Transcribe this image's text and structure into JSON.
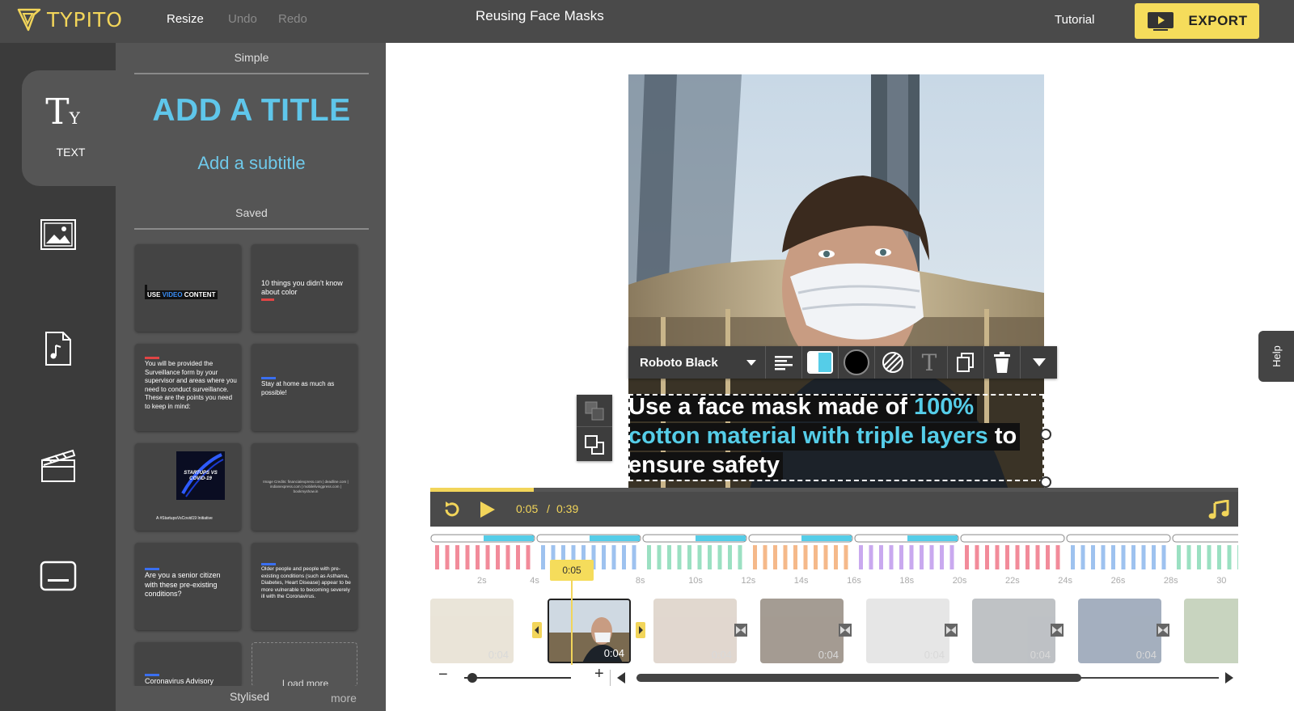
{
  "app": {
    "logo_text": "TYPITO",
    "project_title": "Reusing Face Masks"
  },
  "topbar": {
    "resize": "Resize",
    "undo": "Undo",
    "redo": "Redo",
    "tutorial": "Tutorial",
    "export": "EXPORT"
  },
  "rail": {
    "text_label": "TEXT",
    "items": [
      "text-icon",
      "image-icon",
      "music-file-icon",
      "clapperboard-icon",
      "caption-icon"
    ]
  },
  "panel": {
    "simple_heading": "Simple",
    "add_title": "ADD A TITLE",
    "add_subtitle": "Add a subtitle",
    "saved_heading": "Saved",
    "cards": [
      {
        "line1_a": "USE ",
        "line1_b": "VIDEO",
        "line1_c": " CONTENT"
      },
      {
        "text": "10 things you didn't know about color"
      },
      {
        "text": "You will be provided the Surveillance form by your supervisor and areas where you need to conduct surveillance. These are the points you need to keep in mind:"
      },
      {
        "text": "Stay at home as much as possible!"
      },
      {
        "image_text": "STARTUPS VS COVID-19",
        "caption": "A #StartupsVsCovid19 Initiative"
      },
      {
        "text": "Image Credits: financialexpress.com | deadline.com | indianexpress.com | mobilelivingpress.com | bookmyshow.in"
      },
      {
        "text": "Are you a senior citizen with these pre-existing conditions?"
      },
      {
        "text": "Older people and people with pre-existing conditions (such as Asthama, Diabetes, Heart Disease) appear to be more vulnerable to becoming severely ill with the Coronavirus."
      },
      {
        "text": "Coronavirus Advisory"
      },
      {
        "text": "Load more"
      }
    ],
    "stylised": "Stylised",
    "more": "more"
  },
  "editor": {
    "font_name": "Roboto Black",
    "caption_part1": "Use a face mask made of ",
    "caption_hl1": "100%",
    "caption_hl2": "cotton material with triple layers",
    "caption_part2": " to",
    "caption_part3": "ensure safety",
    "accent_color": "#55cde8"
  },
  "player": {
    "current": "0:05",
    "separator": "/",
    "total": "0:39",
    "progress": 0.128
  },
  "timeline": {
    "playhead": "0:05",
    "ticks": [
      "2s",
      "4s",
      "",
      "8s",
      "10s",
      "12s",
      "14s",
      "16s",
      "18s",
      "20s",
      "22s",
      "24s",
      "26s",
      "28s",
      "30"
    ],
    "clips": [
      "0:04",
      "0:04",
      "0:04",
      "0:04",
      "0:04",
      "0:04",
      "0:04"
    ]
  },
  "help": "Help"
}
